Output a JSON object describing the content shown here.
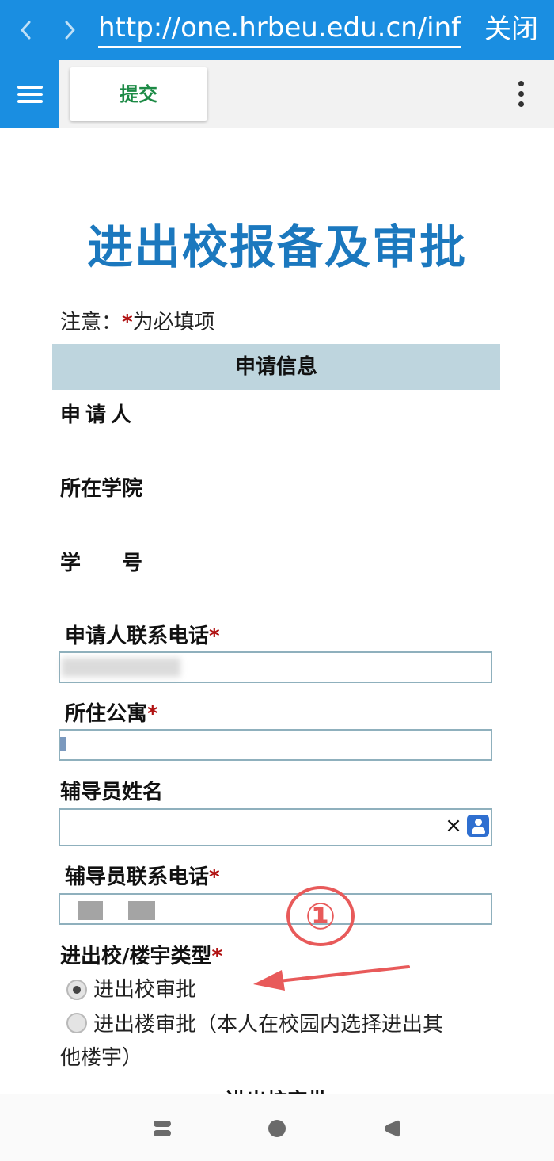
{
  "browser": {
    "url": "http://one.hrbeu.edu.cn/infoplus",
    "close_label": "关闭"
  },
  "toolbar": {
    "submit_label": "提交"
  },
  "form": {
    "title": "进出校报备及审批",
    "notice_prefix": "注意：",
    "notice_star": "*",
    "notice_suffix": "为必填项",
    "section_title": "申请信息",
    "required_mark": "*",
    "labels": {
      "applicant": "申请人",
      "college": "所在学院",
      "student_id": "学　　号",
      "applicant_phone": "申请人联系电话",
      "apartment": "所住公寓",
      "counselor_name": "辅导员姓名",
      "counselor_phone": "辅导员联系电话",
      "type": "进出校/楼宇类型"
    },
    "fields": {
      "applicant_phone_value": "",
      "apartment_value": "",
      "counselor_name_value": "",
      "counselor_phone_value": ""
    },
    "clear_symbol": "×",
    "type_options": [
      {
        "label": "进出校审批",
        "selected": true
      },
      {
        "label": "进出楼审批（本人在校园内选择进出其",
        "selected": false
      }
    ],
    "type_option_2_cont": "他楼宇）",
    "next_section_partial": "进出校审批"
  },
  "annotation": {
    "number": "①",
    "color": "#e85a5a"
  },
  "icons": {
    "back": "chevron-left-icon",
    "forward": "chevron-right-icon",
    "menu": "hamburger-menu-icon",
    "more": "more-vertical-icon",
    "contact": "contact-picker-icon"
  },
  "colors": {
    "brand_blue": "#1a8ee1",
    "title_blue": "#1b78be",
    "submit_green": "#1c8a45",
    "section_bg": "#bed5de",
    "required_red": "#b01010"
  }
}
